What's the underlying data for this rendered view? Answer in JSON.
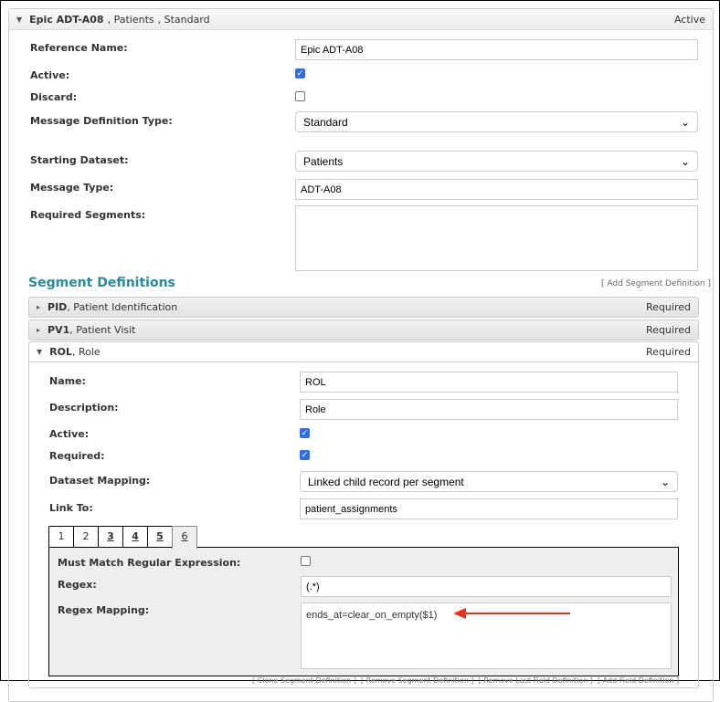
{
  "header": {
    "title": "Epic ADT-A08",
    "dataset": ", Patients",
    "type": ", Standard",
    "status": "Active"
  },
  "form": {
    "reference_name_label": "Reference Name:",
    "reference_name": "Epic ADT-A08",
    "active_label": "Active:",
    "active": true,
    "discard_label": "Discard:",
    "discard": false,
    "message_definition_type_label": "Message Definition Type:",
    "message_definition_type": "Standard",
    "starting_dataset_label": "Starting Dataset:",
    "starting_dataset": "Patients",
    "message_type_label": "Message Type:",
    "message_type": "ADT-A08",
    "required_segments_label": "Required Segments:",
    "required_segments": ""
  },
  "segments": {
    "title": "Segment Definitions",
    "add_link": "[ Add Segment Definition ]",
    "items": [
      {
        "code": "PID",
        "name": ", Patient Identification",
        "status": "Required"
      },
      {
        "code": "PV1",
        "name": ", Patient Visit",
        "status": "Required"
      },
      {
        "code": "ROL",
        "name": ", Role",
        "status": "Required"
      }
    ]
  },
  "rol": {
    "name_label": "Name:",
    "name": "ROL",
    "description_label": "Description:",
    "description": "Role",
    "active_label": "Active:",
    "required_label": "Required:",
    "dataset_mapping_label": "Dataset Mapping:",
    "dataset_mapping": "Linked child record per segment",
    "link_to_label": "Link To:",
    "link_to": "patient_assignments",
    "tabs": [
      "1",
      "2",
      "3",
      "4",
      "5",
      "6"
    ],
    "must_match_label": "Must Match Regular Expression:",
    "regex_label": "Regex:",
    "regex": "(.*)",
    "regex_mapping_label": "Regex Mapping:",
    "regex_mapping": "ends_at=clear_on_empty($1)",
    "footer_links": "[ Clone Segment Definition ]  [ Remove Segment Definition ]  [ Remove Last Field Definition ]  [ Add Field Definition ]"
  },
  "colors": {
    "accent": "#2a8a99",
    "arrow": "#e8321e",
    "checkbox": "#2f6fe4"
  }
}
